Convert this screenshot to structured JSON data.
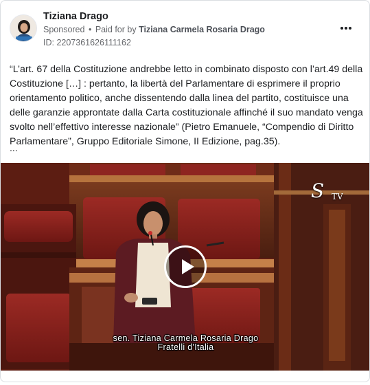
{
  "post": {
    "page_name": "Tiziana Drago",
    "sponsored_label": "Sponsored",
    "separator": "•",
    "paid_for_prefix": "Paid for by",
    "payer_name": "Tiziana Carmela Rosaria Drago",
    "ad_id": "ID: 2207361626111162",
    "body_text": "“L’art. 67 della Costituzione andrebbe letto in combinato disposto con l’art.49 della Costituzione […] : pertanto, la libertà del Parlamentare di esprimere il proprio orientamento politico, anche dissentendo dalla linea del partito, costituisce una delle garanzie approntate dalla Carta costituzionale affinché il suo mandato venga svolto nell’effettivo interesse nazionale” (Pietro Emanuele, “Compendio di Diritto Parlamentare”, Gruppo Editoriale Simone, II Edizione, pag.35).",
    "see_more": "..."
  },
  "video": {
    "channel_logo": "S",
    "channel_suffix": "TV",
    "caption_name": "sen. Tiziana Carmela Rosaria Drago",
    "caption_party": "Fratelli d'Italia",
    "play_icon": "play-icon"
  },
  "icons": {
    "more": "more-horizontal-icon",
    "avatar": "profile-avatar"
  },
  "colors": {
    "secondary_text": "#65676b",
    "primary_text": "#1c1e21",
    "border": "#dadde1"
  }
}
